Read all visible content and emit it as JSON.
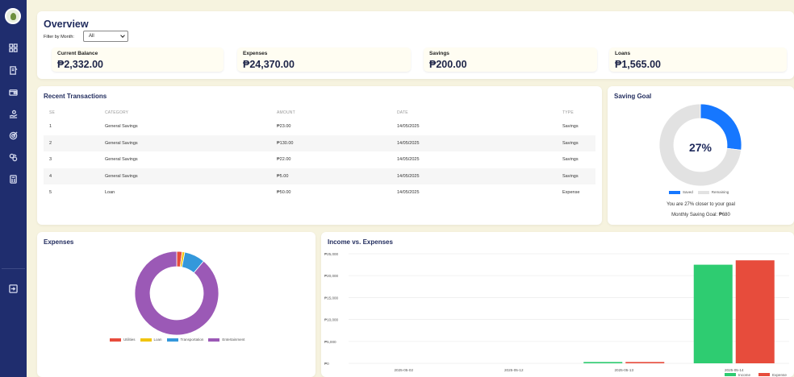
{
  "sidebar": {
    "items": [
      {
        "icon": "dashboard-icon"
      },
      {
        "icon": "notes-icon"
      },
      {
        "icon": "wallet-icon"
      },
      {
        "icon": "money-hand-icon"
      },
      {
        "icon": "target-icon"
      },
      {
        "icon": "bills-icon"
      },
      {
        "icon": "calculator-icon"
      }
    ],
    "logout_icon": "logout-icon"
  },
  "overview": {
    "title": "Overview",
    "filter_label": "Filter by Month:",
    "filter_value": "All",
    "stats": [
      {
        "label": "Current Balance",
        "value": "₱2,332.00"
      },
      {
        "label": "Expenses",
        "value": "₱24,370.00"
      },
      {
        "label": "Savings",
        "value": "₱200.00"
      },
      {
        "label": "Loans",
        "value": "₱1,565.00"
      }
    ]
  },
  "recent": {
    "title": "Recent Transactions",
    "columns": [
      "SE",
      "CATEGORY",
      "AMOUNT",
      "DATE",
      "TYPE"
    ],
    "rows": [
      [
        "1",
        "General Savings",
        "₱23.00",
        "14/05/2025",
        "Savings"
      ],
      [
        "2",
        "General Savings",
        "₱130.00",
        "14/05/2025",
        "Savings"
      ],
      [
        "3",
        "General Savings",
        "₱22.00",
        "14/05/2025",
        "Savings"
      ],
      [
        "4",
        "General Savings",
        "₱5.00",
        "14/05/2025",
        "Savings"
      ],
      [
        "5",
        "Loan",
        "₱50.00",
        "14/05/2025",
        "Expense"
      ]
    ]
  },
  "goal": {
    "title": "Saving Goal",
    "percent_label": "27%",
    "legend": [
      "Saved",
      "Remaining"
    ],
    "message": "You are 27% closer to your goal",
    "monthly_goal": "Monthly Saving Goal: ₱680",
    "colors": {
      "saved": "#1677ff",
      "remaining": "#e2e2e2"
    }
  },
  "expenses": {
    "title": "Expenses",
    "legend": [
      "Utilities",
      "Loan",
      "Transportation",
      "Entertainment"
    ]
  },
  "income": {
    "title": "Income vs. Expenses"
  },
  "chart_data": [
    {
      "type": "pie",
      "title": "Saving Goal",
      "categories": [
        "Saved",
        "Remaining"
      ],
      "values": [
        27,
        73
      ],
      "colors": [
        "#1677ff",
        "#e2e2e2"
      ]
    },
    {
      "type": "pie",
      "title": "Expenses",
      "categories": [
        "Utilities",
        "Loan",
        "Transportation",
        "Entertainment"
      ],
      "values": [
        2.1,
        1.0,
        8.0,
        88.9
      ],
      "colors": [
        "#e74c3c",
        "#f1c40f",
        "#3498db",
        "#9b59b6"
      ]
    },
    {
      "type": "bar",
      "title": "Income vs. Expenses",
      "categories": [
        "2025-05-02",
        "2025-05-12",
        "2025-05-13",
        "2025-05-14"
      ],
      "series": [
        {
          "name": "Income",
          "values": [
            0,
            0,
            300,
            22500
          ],
          "color": "#2ecc71"
        },
        {
          "name": "Expense",
          "values": [
            0,
            0,
            300,
            23500
          ],
          "color": "#e74c3c"
        }
      ],
      "yticks": [
        "₱25,000",
        "₱20,000",
        "₱15,000",
        "₱10,000",
        "₱5,000",
        "₱0"
      ],
      "ylim": [
        0,
        25000
      ],
      "grid": true,
      "legend": "bottom-right"
    }
  ]
}
